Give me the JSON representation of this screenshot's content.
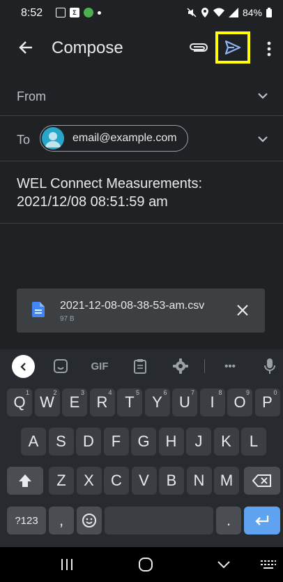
{
  "status_bar": {
    "time": "8:52",
    "battery": "84%"
  },
  "app_bar": {
    "title": "Compose"
  },
  "from": {
    "label": "From"
  },
  "to": {
    "label": "To",
    "recipient": "email@example.com"
  },
  "subject": {
    "line1": "WEL Connect Measurements:",
    "line2": "2021/12/08 08:51:59 am"
  },
  "attachment": {
    "filename": "2021-12-08-08-38-53-am.csv",
    "size": "97 B"
  },
  "keyboard": {
    "toolbar": {
      "gif": "GIF",
      "more": "•••"
    },
    "row1": [
      {
        "k": "Q",
        "h": "1"
      },
      {
        "k": "W",
        "h": "2"
      },
      {
        "k": "E",
        "h": "3"
      },
      {
        "k": "R",
        "h": "4"
      },
      {
        "k": "T",
        "h": "5"
      },
      {
        "k": "Y",
        "h": "6"
      },
      {
        "k": "U",
        "h": "7"
      },
      {
        "k": "I",
        "h": "8"
      },
      {
        "k": "O",
        "h": "9"
      },
      {
        "k": "P",
        "h": "0"
      }
    ],
    "row2": [
      "A",
      "S",
      "D",
      "F",
      "G",
      "H",
      "J",
      "K",
      "L"
    ],
    "row3": [
      "Z",
      "X",
      "C",
      "V",
      "B",
      "N",
      "M"
    ],
    "symbols_key": "?123",
    "comma_key": ",",
    "period_key": "."
  },
  "colors": {
    "background": "#202124",
    "highlight": "#ffff00",
    "accent": "#5ea2f0",
    "avatar": "#28a6c9"
  }
}
